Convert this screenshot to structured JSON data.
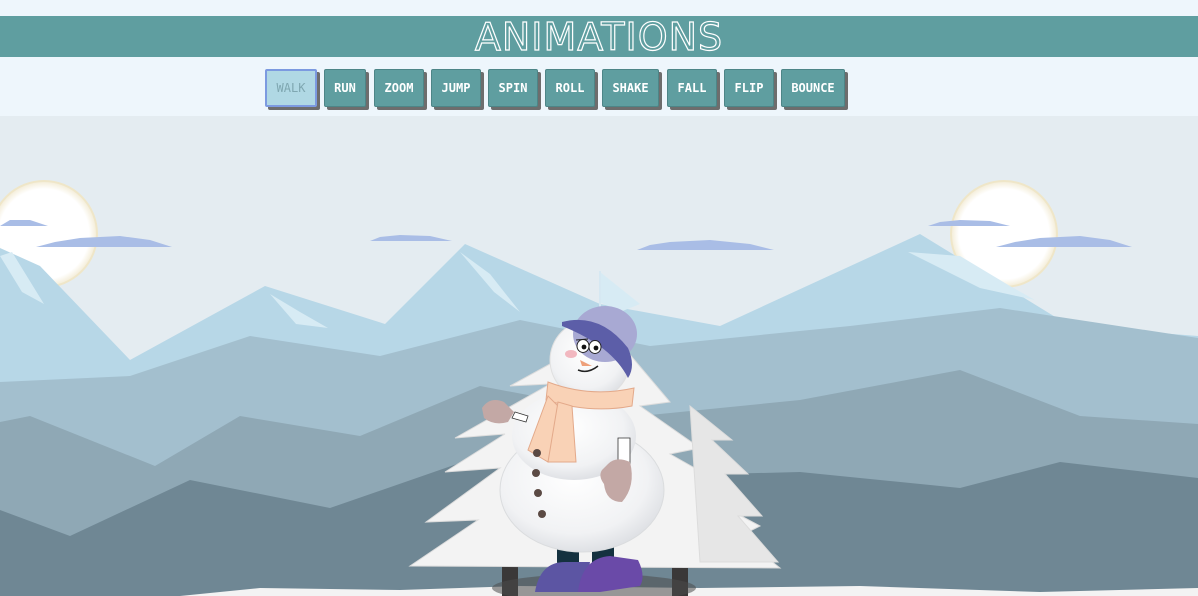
{
  "app": {
    "title": "ANIMATIONS"
  },
  "buttons": [
    {
      "label": "WALK",
      "active": true
    },
    {
      "label": "RUN",
      "active": false
    },
    {
      "label": "ZOOM",
      "active": false
    },
    {
      "label": "JUMP",
      "active": false
    },
    {
      "label": "SPIN",
      "active": false
    },
    {
      "label": "ROLL",
      "active": false
    },
    {
      "label": "SHAKE",
      "active": false
    },
    {
      "label": "FALL",
      "active": false
    },
    {
      "label": "FLIP",
      "active": false
    },
    {
      "label": "BOUNCE",
      "active": false
    }
  ],
  "colors": {
    "accent": "#5f9ea0",
    "active_button": "#b0d8e4",
    "sky": "#e4ecf1",
    "hat": "#7c7fc4",
    "scarf": "#f9d2b6",
    "boots": "#5c4a9e"
  },
  "scene": {
    "icons": [
      "sun-icon",
      "cloud-icon",
      "mountain-icon",
      "pine-tree-icon",
      "snowman-icon"
    ]
  }
}
